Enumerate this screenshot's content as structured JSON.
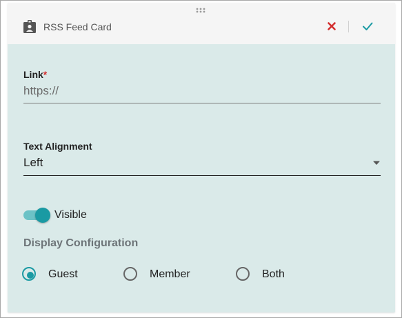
{
  "header": {
    "title": "RSS Feed Card",
    "cancel_icon": "close-icon",
    "confirm_icon": "check-icon",
    "card_icon": "id-badge-icon"
  },
  "form": {
    "link": {
      "label": "Link",
      "required_marker": "*",
      "placeholder": "https://",
      "value": ""
    },
    "text_alignment": {
      "label": "Text Alignment",
      "value": "Left"
    },
    "visible_toggle": {
      "label": "Visible",
      "on": true
    },
    "display_configuration": {
      "title": "Display Configuration",
      "options": [
        {
          "label": "Guest",
          "checked": true
        },
        {
          "label": "Member",
          "checked": false
        },
        {
          "label": "Both",
          "checked": false
        }
      ]
    }
  },
  "colors": {
    "accent": "#1a9aa3",
    "card_background": "#daeae9",
    "cancel": "#d32f2f",
    "header_background": "#f5f5f5"
  }
}
